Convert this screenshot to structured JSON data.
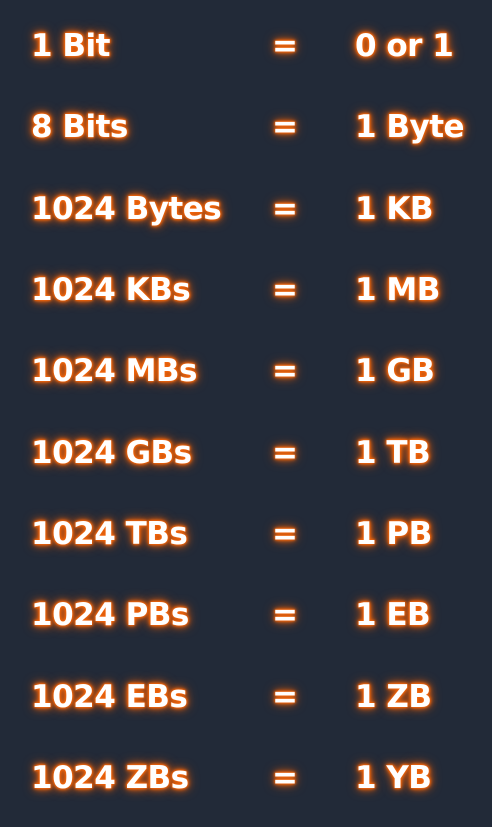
{
  "rows": [
    {
      "left": "1 Bit",
      "eq": "=",
      "right": "0 or 1"
    },
    {
      "left": "8 Bits",
      "eq": "=",
      "right": "1 Byte"
    },
    {
      "left": "1024 Bytes",
      "eq": "=",
      "right": "1 KB"
    },
    {
      "left": "1024 KBs",
      "eq": "=",
      "right": "1 MB"
    },
    {
      "left": "1024 MBs",
      "eq": "=",
      "right": "1 GB"
    },
    {
      "left": "1024 GBs",
      "eq": "=",
      "right": "1 TB"
    },
    {
      "left": "1024 TBs",
      "eq": "=",
      "right": "1 PB"
    },
    {
      "left": "1024 PBs",
      "eq": "=",
      "right": "1 EB"
    },
    {
      "left": "1024 EBs",
      "eq": "=",
      "right": "1 ZB"
    },
    {
      "left": "1024 ZBs",
      "eq": "=",
      "right": "1 YB"
    }
  ],
  "colors": {
    "background": "#222a38",
    "text": "#ffffff",
    "glow": "#f5650a"
  }
}
